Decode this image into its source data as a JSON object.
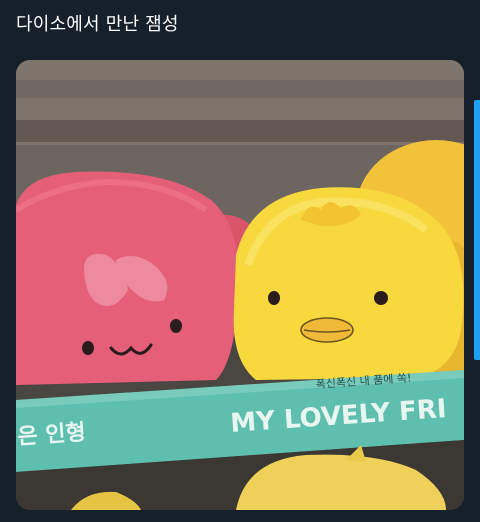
{
  "tweet": {
    "text": "다이소에서 만난 잼성"
  },
  "photo": {
    "shelf_strip": {
      "small_text": "폭신폭신 내 품에 쏙!",
      "left_text": "은 인형",
      "big_text": "MY LOVELY FRI"
    }
  },
  "colors": {
    "background": "#15202b",
    "text": "#ffffff",
    "accent": "#1da1f2"
  }
}
